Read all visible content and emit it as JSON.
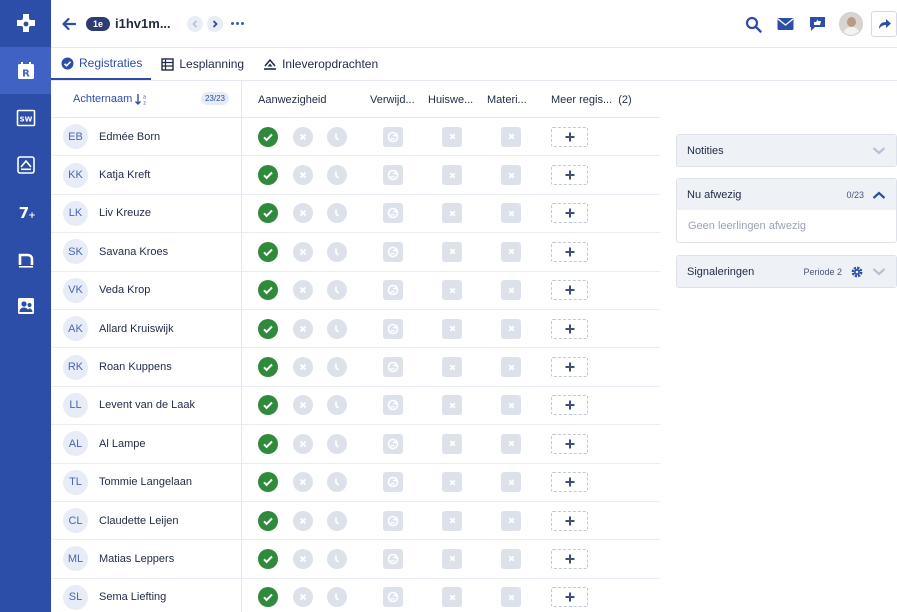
{
  "app": {
    "brand_color": "#2d4ea8"
  },
  "rail": {
    "items": [
      {
        "icon": "registration-icon",
        "active": true
      },
      {
        "icon": "sw-icon"
      },
      {
        "icon": "assignments-icon"
      },
      {
        "icon": "seven-plus-icon"
      },
      {
        "icon": "notes-n-icon"
      },
      {
        "icon": "students-icon"
      }
    ]
  },
  "topbar": {
    "badge": "1e",
    "class_name": "i1hv1m..."
  },
  "tabs": [
    {
      "label": "Registraties",
      "icon": "check-circle-icon",
      "active": true
    },
    {
      "label": "Lesplanning",
      "icon": "table-icon"
    },
    {
      "label": "Inleveropdrachten",
      "icon": "assignment-icon"
    }
  ],
  "grid": {
    "sort_label": "Achternaam",
    "count": "23/23",
    "columns": [
      {
        "label": "Aanwezigheid"
      },
      {
        "label": "Verwijd..."
      },
      {
        "label": "Huiswe..."
      },
      {
        "label": "Materi..."
      },
      {
        "label": "Meer regis...  (2)"
      }
    ],
    "students": [
      {
        "initials": "EB",
        "name": "Edmée Born"
      },
      {
        "initials": "KK",
        "name": "Katja Kreft"
      },
      {
        "initials": "LK",
        "name": "Liv Kreuze"
      },
      {
        "initials": "SK",
        "name": "Savana Kroes"
      },
      {
        "initials": "VK",
        "name": "Veda Krop"
      },
      {
        "initials": "AK",
        "name": "Allard Kruiswijk"
      },
      {
        "initials": "RK",
        "name": "Roan Kuppens"
      },
      {
        "initials": "LL",
        "name": "Levent van de Laak"
      },
      {
        "initials": "AL",
        "name": "Al Lampe"
      },
      {
        "initials": "TL",
        "name": "Tommie Langelaan"
      },
      {
        "initials": "CL",
        "name": "Claudette Leijen"
      },
      {
        "initials": "ML",
        "name": "Matias Leppers"
      },
      {
        "initials": "SL",
        "name": "Sema Liefting"
      }
    ]
  },
  "panels": {
    "notities": {
      "title": "Notities"
    },
    "afwezig": {
      "title": "Nu afwezig",
      "count": "0/23",
      "empty": "Geen leerlingen afwezig"
    },
    "signaleringen": {
      "title": "Signaleringen",
      "period": "Periode 2"
    }
  }
}
